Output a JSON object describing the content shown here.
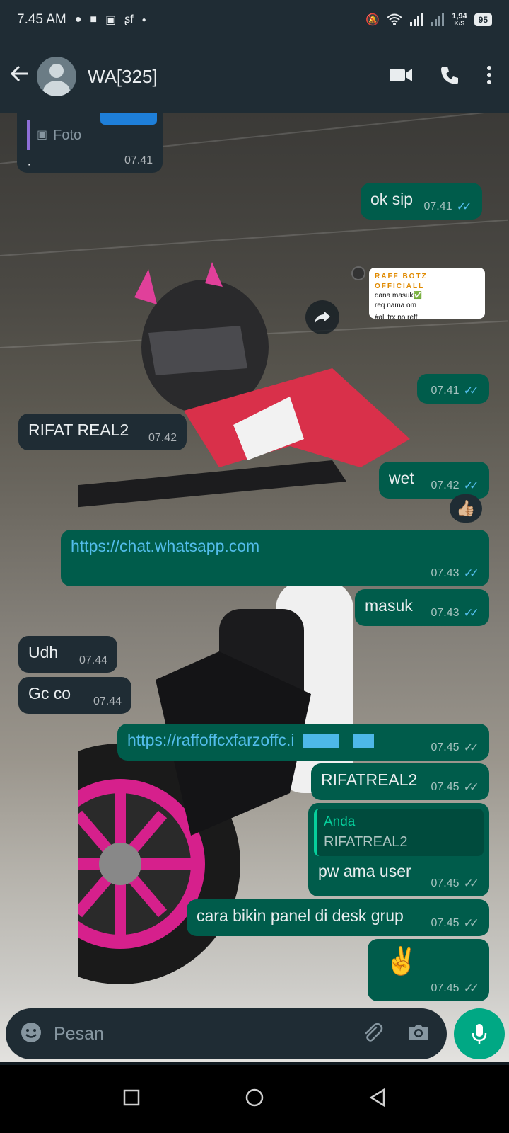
{
  "status_bar": {
    "time": "7.45 AM",
    "speed_value": "1,94",
    "speed_unit": "K/S",
    "battery": "95"
  },
  "header": {
    "contact_name": "WA[325]",
    "icons": [
      "back-arrow-icon",
      "video-call-icon",
      "voice-call-icon",
      "more-options-icon"
    ]
  },
  "messages": {
    "m0": {
      "label": "Foto",
      "text": "·",
      "time": "07.41"
    },
    "m1": {
      "text": "ok sip",
      "time": "07.41"
    },
    "sticker": {
      "title": "RAFF BOTZ OFFICIALL",
      "line1": "dana masuk✅",
      "line2": "req nama om",
      "line3": "#all trx no reff"
    },
    "m2": {
      "time": "07.41"
    },
    "m3": {
      "text": "RIFAT REAL2",
      "time": "07.42"
    },
    "m4": {
      "text": "wet",
      "time": "07.42",
      "reaction": "👍🏼"
    },
    "m5": {
      "text": "https://chat.whatsapp.com",
      "time": "07.43"
    },
    "m6": {
      "text": "masuk",
      "time": "07.43"
    },
    "m7": {
      "text": "Udh",
      "time": "07.44"
    },
    "m8": {
      "text": "Gc co",
      "time": "07.44"
    },
    "m9": {
      "text": "https://raffoffcxfarzoffc.i",
      "time": "07.45"
    },
    "m10": {
      "text": "RIFATREAL2",
      "time": "07.45"
    },
    "m11": {
      "quote_author": "Anda",
      "quote_text": "RIFATREAL2",
      "text": "pw ama user",
      "time": "07.45"
    },
    "m12": {
      "text": "cara bikin panel di desk grup",
      "time": "07.45"
    },
    "m13": {
      "text": "✌️",
      "time": "07.45"
    }
  },
  "input": {
    "placeholder": "Pesan"
  },
  "colors": {
    "incoming_bubble": "#1f2c34",
    "outgoing_bubble": "#005c4b",
    "accent": "#00a884",
    "read_tick": "#53bdeb"
  }
}
